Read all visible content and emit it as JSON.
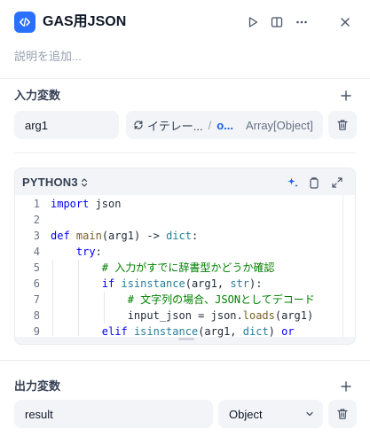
{
  "header": {
    "title": "GAS用JSON",
    "description_placeholder": "説明を追加..."
  },
  "input_section": {
    "title": "入力変数",
    "variables": [
      {
        "name": "arg1",
        "ref_node": "イテレー...",
        "ref_var": "o...",
        "ref_type": "Array[Object]"
      }
    ]
  },
  "code": {
    "language": "PYTHON3",
    "line_numbers": [
      "1",
      "2",
      "3",
      "4",
      "5",
      "6",
      "7",
      "8",
      "9"
    ],
    "lines": [
      "import json",
      "",
      "def main(arg1) -> dict:",
      "    try:",
      "        # 入力がすでに辞書型かどうか確認",
      "        if isinstance(arg1, str):",
      "            # 文字列の場合、JSONとしてデコード",
      "            input_json = json.loads(arg1)",
      "        elif isinstance(arg1, dict) or"
    ]
  },
  "output_section": {
    "title": "出力変数",
    "variables": [
      {
        "name": "result",
        "type": "Object"
      }
    ]
  },
  "colors": {
    "accent": "#2970ff",
    "field_bg": "#f2f4f7",
    "divider": "#eaecf0",
    "keyword": "#0000ff",
    "comment": "#008000"
  }
}
